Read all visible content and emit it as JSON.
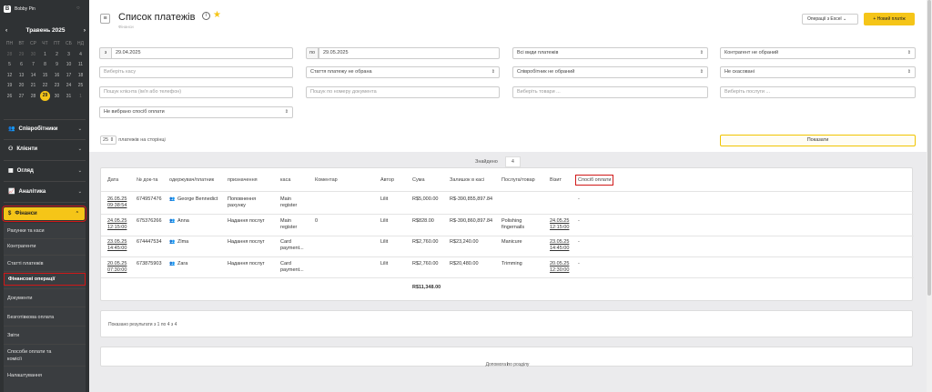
{
  "app": {
    "name": "Bobby Pin",
    "logo_letter": "B"
  },
  "calendar": {
    "month": "Травень 2025",
    "prev": "‹",
    "next": "›",
    "weekdays": [
      "ПН",
      "ВТ",
      "СР",
      "ЧТ",
      "ПТ",
      "СБ",
      "НД"
    ],
    "days": [
      [
        "28",
        "29",
        "30",
        "1",
        "2",
        "3",
        "4"
      ],
      [
        "5",
        "6",
        "7",
        "8",
        "9",
        "10",
        "11"
      ],
      [
        "12",
        "13",
        "14",
        "15",
        "16",
        "17",
        "18"
      ],
      [
        "19",
        "20",
        "21",
        "22",
        "23",
        "24",
        "25"
      ],
      [
        "26",
        "27",
        "28",
        "29",
        "30",
        "31",
        "1"
      ]
    ],
    "selected": "29"
  },
  "nav": {
    "employees": "Співробітники",
    "clients": "Клієнти",
    "overview": "Огляд",
    "analytics": "Аналітика",
    "finance": "Фінанси"
  },
  "submenu": [
    "Рахунки та каси",
    "Контрагенти",
    "Статті платежів",
    "Фінансові операції",
    "Документи",
    "Безготівкова оплата",
    "Звіти",
    "Способи оплати та",
    "комісії",
    "Налаштування"
  ],
  "header": {
    "title": "Список платежів",
    "breadcrumb": "Фінанси",
    "excel_button": "Операції з Excel",
    "new_button": "+ Новий платіж"
  },
  "filters": {
    "from_label": "з",
    "from_date": "29.04.2025",
    "to_label": "по",
    "to_date": "29.05.2025",
    "payment_types": "Всі види платежів",
    "counterparty": "Контрагент не обраний",
    "cashbox_placeholder": "Виберіть касу",
    "payment_article": "Стаття платежу не обрана",
    "employee": "Співробітник не обраний",
    "cancelled": "Не скасовані",
    "client_search_placeholder": "Пошук клієнта (ім'я або телефон)",
    "doc_search_placeholder": "Пошук по номеру документа",
    "goods_placeholder": "Виберіть товари ...",
    "services_placeholder": "Виберіть послуги ...",
    "payment_method": "Не вибрано спосіб оплати",
    "per_page": "25",
    "per_page_label": "платежів на сторінці",
    "show_button": "Показати"
  },
  "found": {
    "label": "Знайдено",
    "count": "4"
  },
  "table": {
    "headers": [
      "Дата",
      "№ док-та",
      "одержувач/платник",
      "призначення",
      "каса",
      "Коментар",
      "Автор",
      "Сума",
      "Залишок в касі",
      "Послуга/товар",
      "Візит",
      "Спосіб оплати"
    ],
    "rows": [
      {
        "date1": "26.05.25",
        "date2": "09:38:54",
        "doc": "674957476",
        "payer": "George Bennedict",
        "purpose1": "Поповнення",
        "purpose2": "рахунку",
        "cash1": "Main",
        "cash2": "register",
        "comment": "",
        "author": "Lilit",
        "sum": "R$5,000.00",
        "balance": "R$-390,855,897.84",
        "service1": "",
        "service2": "",
        "visit1": "",
        "visit2": "",
        "method": "-"
      },
      {
        "date1": "24.05.25",
        "date2": "12:15:00",
        "doc": "675376266",
        "payer": "Anna",
        "purpose1": "Надання послуг",
        "purpose2": "",
        "cash1": "Main",
        "cash2": "register",
        "comment": "0",
        "author": "Lilit",
        "sum": "R$828.00",
        "balance": "R$-390,860,897.84",
        "service1": "Polishing",
        "service2": "fingernails",
        "visit1": "24.05.25",
        "visit2": "12:15:00",
        "method": "-"
      },
      {
        "date1": "23.05.25",
        "date2": "14:45:00",
        "doc": "674447534",
        "payer": "Zlma",
        "purpose1": "Надання послуг",
        "purpose2": "",
        "cash1": "Card",
        "cash2": "payment...",
        "comment": "",
        "author": "Lilit",
        "sum": "R$2,760.00",
        "balance": "R$23,240.00",
        "service1": "Manicure",
        "service2": "",
        "visit1": "23.05.25",
        "visit2": "14:45:00",
        "method": "-"
      },
      {
        "date1": "20.05.25",
        "date2": "07:30:00",
        "doc": "673875903",
        "payer": "Zara",
        "purpose1": "Надання послуг",
        "purpose2": "",
        "cash1": "Card",
        "cash2": "payment...",
        "comment": "",
        "author": "Lilit",
        "sum": "R$2,760.00",
        "balance": "R$20,480.00",
        "service1": "Trimming",
        "service2": "",
        "visit1": "20.05.25",
        "visit2": "12:30:00",
        "method": "-"
      }
    ],
    "total": "R$11,348.00"
  },
  "results_text": "Показано результати з 1 по 4 з 4",
  "help_text": "Допомога по розділу",
  "colors": {
    "accent": "#f5c518",
    "sidebar": "#2f3234",
    "highlight": "#d01818"
  }
}
